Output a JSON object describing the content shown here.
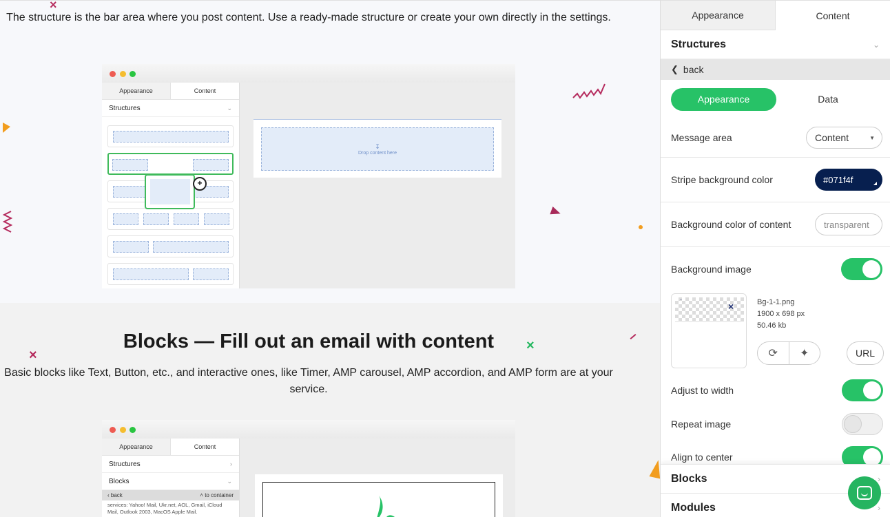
{
  "content": {
    "structure_text": "The structure is the bar area where you post content. Use a ready-made structure or create your own directly in the settings.",
    "blocks_heading": "Blocks — Fill out an email with content",
    "blocks_text": "Basic blocks like Text, Button, etc., and interactive ones, like Timer, AMP carousel, AMP accordion, and AMP form are at your service."
  },
  "mockup1": {
    "tab_appearance": "Appearance",
    "tab_content": "Content",
    "section": "Structures",
    "drop_text": "Drop content here"
  },
  "mockup2": {
    "tab_appearance": "Appearance",
    "tab_content": "Content",
    "structures": "Structures",
    "blocks": "Blocks",
    "back": "back",
    "to_container": "to container",
    "small_text": "services: Yahoo! Mail, Ukr.net, AOL, Gmail, iCloud Mail, Outlook 2003, MacOS Apple Mail."
  },
  "panel": {
    "tabs": [
      "Appearance",
      "Content"
    ],
    "active_tab": "Content",
    "section_title": "Structures",
    "back_label": "back",
    "subtab_active": "Appearance",
    "subtab_inactive": "Data",
    "message_area_label": "Message area",
    "message_area_value": "Content",
    "stripe_bg_label": "Stripe background color",
    "stripe_bg_value": "#071f4f",
    "content_bg_label": "Background color of content",
    "content_bg_value": "transparent",
    "bg_image_label": "Background image",
    "bg_image_enabled": true,
    "image_name": "Bg-1-1.png",
    "image_dims": "1900 x 698 px",
    "image_size": "50.46 kb",
    "url_button": "URL",
    "adjust_width_label": "Adjust to width",
    "adjust_width_enabled": true,
    "repeat_image_label": "Repeat image",
    "repeat_image_enabled": false,
    "align_center_label": "Align to center",
    "align_center_enabled": true,
    "blocks_section": "Blocks",
    "modules_section": "Modules"
  },
  "colors": {
    "accent_green": "#27c267",
    "stripe_color": "#071f4f"
  },
  "icons": [
    "close-x-icon",
    "chevron-down-icon",
    "chevron-left-icon",
    "caret-down-icon",
    "refresh-icon",
    "magic-wand-icon",
    "chat-icon",
    "move-cursor-icon"
  ]
}
